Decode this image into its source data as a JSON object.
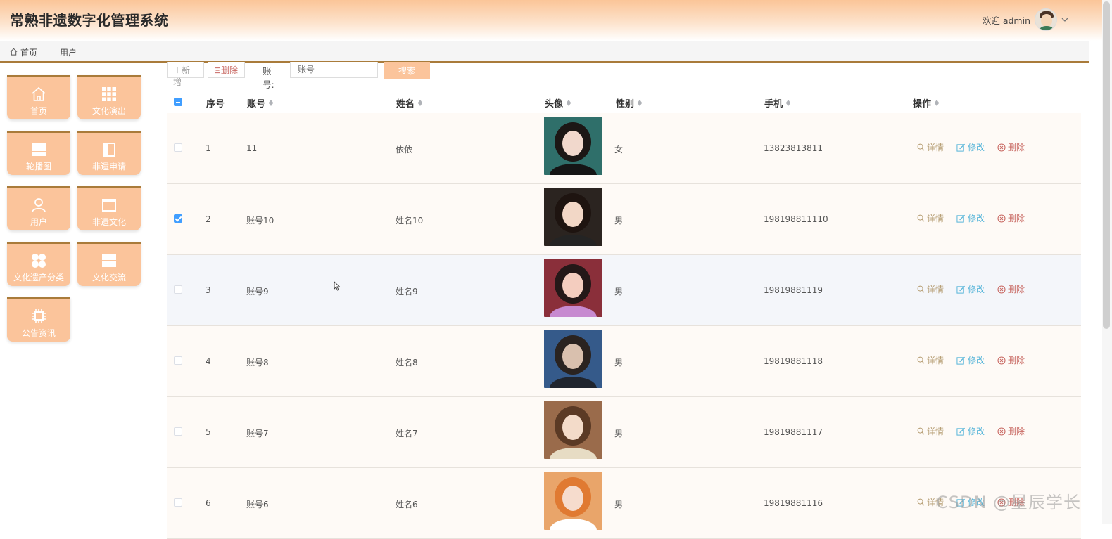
{
  "header": {
    "title": "常熟非遗数字化管理系统",
    "welcome": "欢迎 admin"
  },
  "breadcrumb": {
    "home": "首页",
    "separator": "—",
    "current": "用户"
  },
  "sidebar": {
    "items": [
      {
        "label": "首页",
        "icon": "home-icon"
      },
      {
        "label": "文化演出",
        "icon": "grid-icon"
      },
      {
        "label": "轮播图",
        "icon": "carousel-icon"
      },
      {
        "label": "非遗申请",
        "icon": "book-icon"
      },
      {
        "label": "用户",
        "icon": "user-icon"
      },
      {
        "label": "非遗文化",
        "icon": "window-icon"
      },
      {
        "label": "文化遗产分类",
        "icon": "apps-icon"
      },
      {
        "label": "文化交流",
        "icon": "layers-icon"
      },
      {
        "label": "公告资讯",
        "icon": "chip-icon"
      }
    ]
  },
  "toolbar": {
    "add_label": "＋新增",
    "delete_label": "⊟删除",
    "account_label": "账号:",
    "account_placeholder": "账号",
    "search_label": "搜索"
  },
  "table": {
    "columns": {
      "index": "序号",
      "account": "账号",
      "name": "姓名",
      "avatar": "头像",
      "gender": "性别",
      "phone": "手机",
      "actions": "操作"
    },
    "action_labels": {
      "detail": "详情",
      "edit": "修改",
      "delete": "删除"
    },
    "rows": [
      {
        "index": "1",
        "account": "11",
        "name": "依依",
        "gender": "女",
        "phone": "13823813811",
        "checked": false
      },
      {
        "index": "2",
        "account": "账号10",
        "name": "姓名10",
        "gender": "男",
        "phone": "198198811110",
        "checked": true
      },
      {
        "index": "3",
        "account": "账号9",
        "name": "姓名9",
        "gender": "男",
        "phone": "19819881119",
        "checked": false
      },
      {
        "index": "4",
        "account": "账号8",
        "name": "姓名8",
        "gender": "男",
        "phone": "19819881118",
        "checked": false
      },
      {
        "index": "5",
        "account": "账号7",
        "name": "姓名7",
        "gender": "男",
        "phone": "19819881117",
        "checked": false
      },
      {
        "index": "6",
        "account": "账号6",
        "name": "姓名6",
        "gender": "男",
        "phone": "19819881116",
        "checked": false
      }
    ]
  },
  "watermark": "CSDN @星辰学长",
  "colors": {
    "accent": "#fbc49b",
    "border_accent": "#a97b3a",
    "checkbox": "#409eff",
    "detail": "#b39a6e",
    "edit": "#5bb7da",
    "delete": "#c96a64"
  }
}
